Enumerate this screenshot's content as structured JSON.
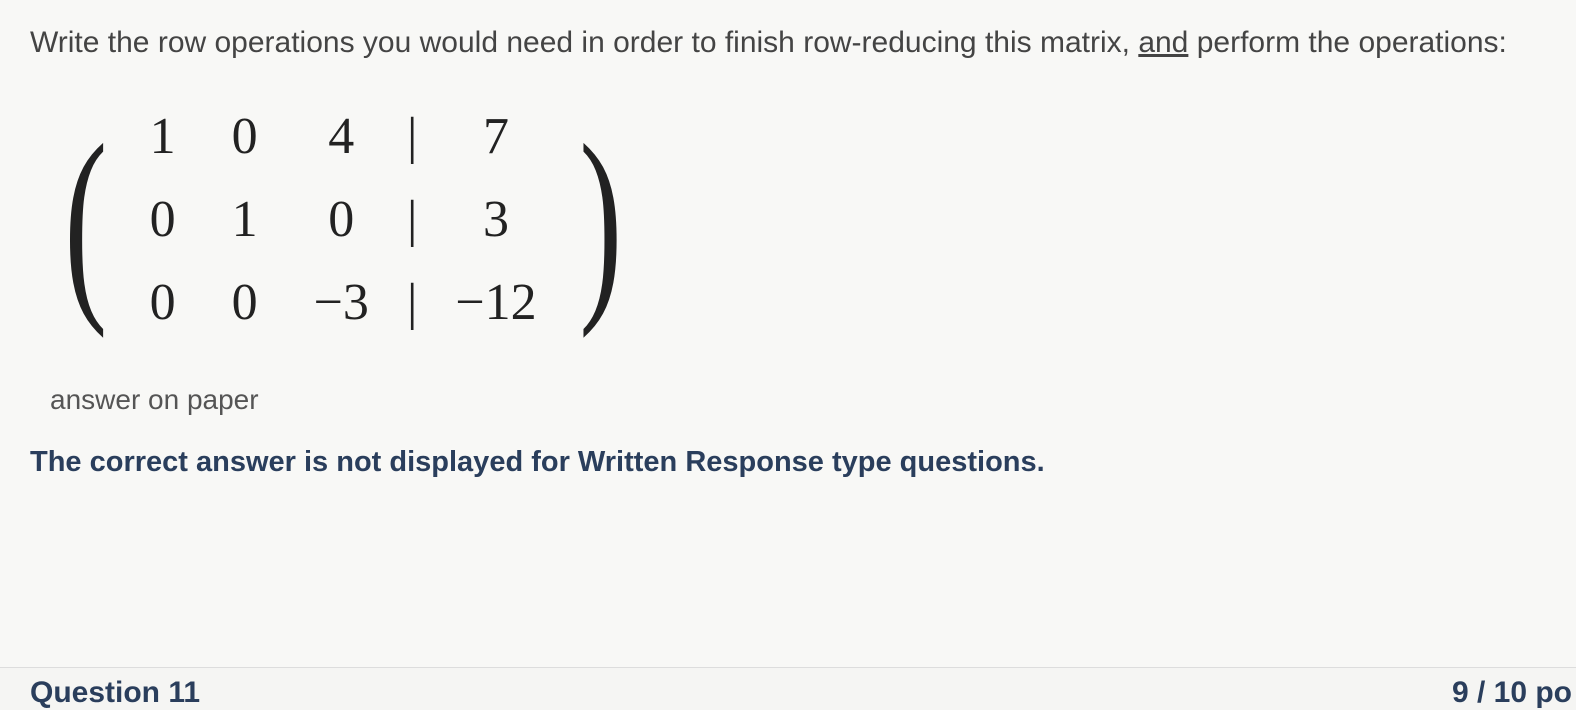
{
  "instruction": {
    "part1": "Write the row operations you would need in order to finish row-reducing this matrix, ",
    "underlined": "and",
    "part2": " perform the operations:"
  },
  "matrix": {
    "r1c1": "1",
    "r1c2": "0",
    "r1c3": "4",
    "r1bar": "|",
    "r1c4": "7",
    "r2c1": "0",
    "r2c2": "1",
    "r2c3": "0",
    "r2bar": "|",
    "r2c4": "3",
    "r3c1": "0",
    "r3c2": "0",
    "r3c3": "−3",
    "r3bar": "|",
    "r3c4": "−12"
  },
  "answer_note": "answer on paper",
  "feedback": "The correct answer is not displayed for Written Response type questions.",
  "footer": {
    "question": "Question 11",
    "points": "9 / 10 po"
  }
}
